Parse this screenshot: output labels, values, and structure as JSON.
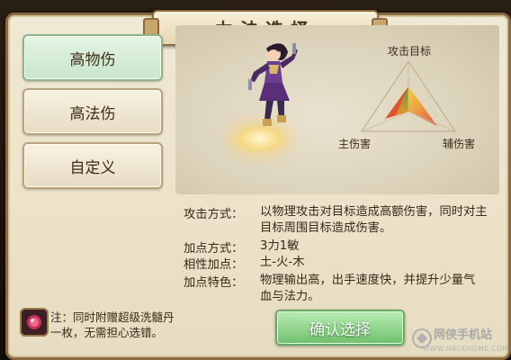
{
  "window": {
    "title": "力法选择"
  },
  "options": [
    {
      "label": "高物伤",
      "selected": true
    },
    {
      "label": "高法伤",
      "selected": false
    },
    {
      "label": "自定义",
      "selected": false
    }
  ],
  "radar": {
    "top_label": "攻击目标",
    "left_label": "主伤害",
    "right_label": "辅伤害"
  },
  "info": {
    "attack_mode_key": "攻击方式：",
    "attack_mode_line1": "以物理攻击对目标造成高额伤害，同时对主",
    "attack_mode_line2": "目标周围目标造成伤害。",
    "points_key": "加点方式：",
    "points_value": "3力1敏",
    "affinity_key": "相性加点：",
    "affinity_value": "土-火-木",
    "trait_key": "加点特色：",
    "trait_line1": "物理输出高，出手速度快，并提升少量气",
    "trait_line2": "血与法力。"
  },
  "confirm_label": "确认选择",
  "note": {
    "line1": "注：同时附赠超级洗髓丹",
    "line2": "一枚，无需担心选错。"
  },
  "watermark": {
    "text": "网侠手机站",
    "url": "WWW.HACKHOME.COM"
  },
  "colors": {
    "selected_option": "#c9e6cb",
    "confirm_button": "#6fc06c",
    "panel": "#ece3ca",
    "border": "#8a6a42"
  }
}
